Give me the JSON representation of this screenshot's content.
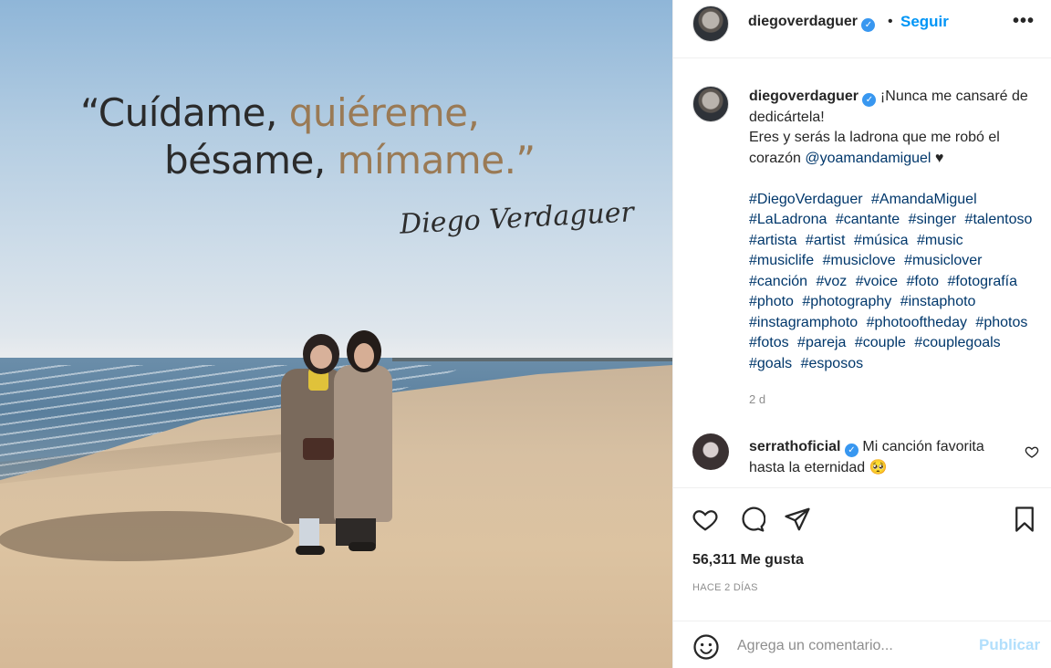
{
  "image": {
    "quote_line1_a": "“Cuídame, ",
    "quote_line1_b": "quiéreme,",
    "quote_line2_a": "bésame, ",
    "quote_line2_b": "mímame.”",
    "signature": "Diego Verdaguer"
  },
  "header": {
    "username": "diegoverdaguer",
    "separator": "•",
    "follow_label": "Seguir",
    "more_label": "•••"
  },
  "caption": {
    "username": "diegoverdaguer",
    "text_1": " ¡Nunca me cansaré de dedicártela!",
    "text_2": "Eres y serás la ladrona que me robó el corazón ",
    "mention": "@yoamandamiguel",
    "heart": " ♥",
    "hashtags": [
      "#DiegoVerdaguer",
      "#AmandaMiguel",
      "#LaLadrona",
      "#cantante",
      "#singer",
      "#talentoso",
      "#artista",
      "#artist",
      "#música",
      "#music",
      "#musiclife",
      "#musiclove",
      "#musiclover",
      "#canción",
      "#voz",
      "#voice",
      "#foto",
      "#fotografía",
      "#photo",
      "#photography",
      "#instaphoto",
      "#instagramphoto",
      "#photooftheday",
      "#photos",
      "#fotos",
      "#pareja",
      "#couple",
      "#couplegoals",
      "#goals",
      "#esposos"
    ],
    "age": "2 d"
  },
  "comment": {
    "username": "serrathoficial",
    "text": " Mi canción favorita hasta la eternidad 🥺"
  },
  "stats": {
    "likes": "56,311 Me gusta",
    "date": "HACE 2 DÍAS"
  },
  "add_comment": {
    "placeholder": "Agrega un comentario...",
    "publish_label": "Publicar"
  },
  "colors": {
    "link": "#00376b",
    "follow": "#0095f6",
    "verified": "#3897f0",
    "publish_disabled": "#b2dffc"
  },
  "icons": [
    "emoji-icon",
    "heart-icon",
    "comment-icon",
    "share-icon",
    "bookmark-icon",
    "verified-icon",
    "more-icon"
  ]
}
